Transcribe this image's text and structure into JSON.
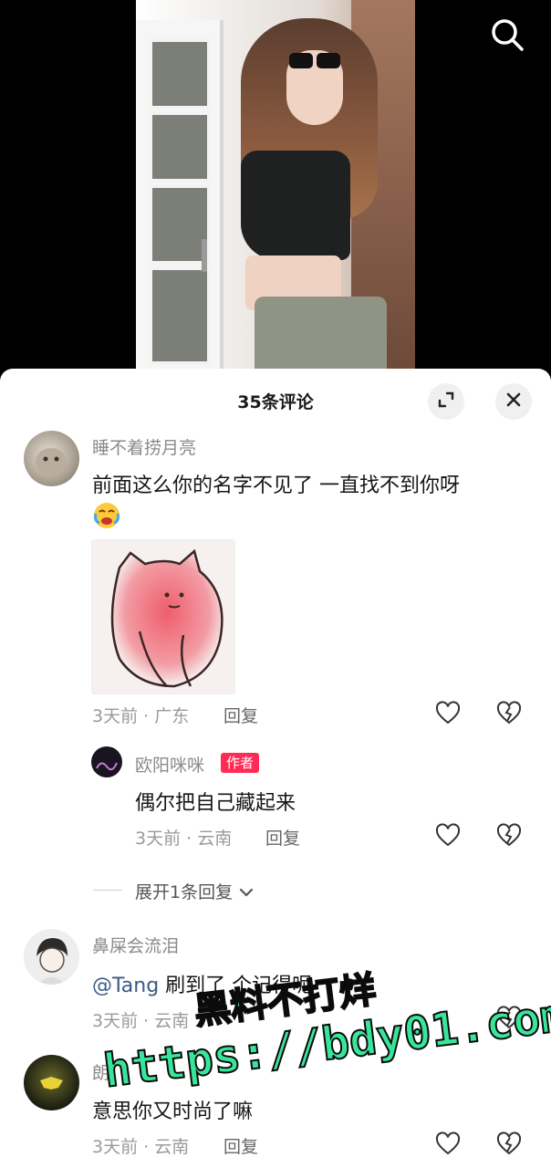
{
  "video": {
    "search_icon": "search-icon"
  },
  "sheet": {
    "title": "35条评论",
    "expand_icon": "expand-icon",
    "close_icon": "close-icon"
  },
  "comments": [
    {
      "username": "睡不着捞月亮",
      "text": "前面这么你的名字不见了 一直找不到你呀",
      "emoji": "crying-emoji",
      "sticker": "pink-cat-sticker",
      "meta": "3天前 · 广东",
      "reply_label": "回复"
    },
    {
      "username": "欧阳咪咪",
      "badge": "作者",
      "text": "偶尔把自己藏起来",
      "meta": "3天前 · 云南",
      "reply_label": "回复"
    },
    {
      "username": "鼻屎会流泪",
      "mention": "@Tang",
      "text": " 刷到了 个记得呢",
      "meta": "3天前 · 云南",
      "reply_label": "回复"
    },
    {
      "username": "朗",
      "text": "意思你又时尚了嘛",
      "meta": "3天前 · 云南",
      "reply_label": "回复"
    }
  ],
  "expand_replies": "展开1条回复",
  "watermark": {
    "line1": "黑料不打烊",
    "line2": "https://bdy01.com"
  },
  "colors": {
    "accent_badge": "#fe2c55",
    "watermark_green": "#38e59a"
  }
}
